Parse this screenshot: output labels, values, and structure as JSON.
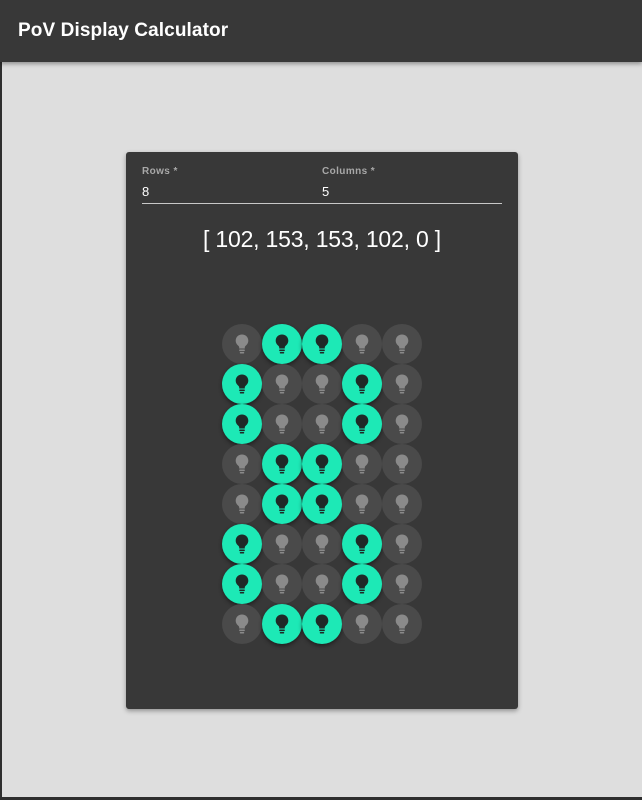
{
  "app": {
    "title": "PoV Display Calculator"
  },
  "form": {
    "rows": {
      "label": "Rows *",
      "value": "8"
    },
    "columns": {
      "label": "Columns *",
      "value": "5"
    }
  },
  "output": {
    "text": "[ 102, 153, 153, 102, 0 ]",
    "values": [
      102,
      153,
      153,
      102,
      0
    ]
  },
  "grid": {
    "rows": 8,
    "columns": 5,
    "cells": [
      [
        0,
        1,
        1,
        0,
        0
      ],
      [
        1,
        0,
        0,
        1,
        0
      ],
      [
        1,
        0,
        0,
        1,
        0
      ],
      [
        0,
        1,
        1,
        0,
        0
      ],
      [
        0,
        1,
        1,
        0,
        0
      ],
      [
        1,
        0,
        0,
        1,
        0
      ],
      [
        1,
        0,
        0,
        1,
        0
      ],
      [
        0,
        1,
        1,
        0,
        0
      ]
    ],
    "icon": "lightbulb-icon"
  },
  "colors": {
    "app_bar": "#383838",
    "background": "#dedede",
    "card": "#383838",
    "led_on": "#1de9b6",
    "led_off": "#4a4a4a"
  }
}
